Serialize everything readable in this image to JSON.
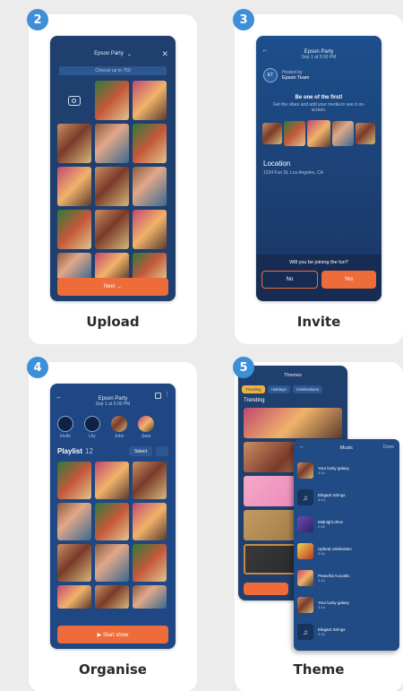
{
  "cards": [
    {
      "number": "2",
      "label": "Upload",
      "header_title": "Epson Party",
      "header_sub": "Choose up to 750",
      "next_label": "Next →"
    },
    {
      "number": "3",
      "label": "Invite",
      "event_title": "Epson Party",
      "event_date": "Sep 1 at 5:00 PM",
      "host_initials": "ET",
      "host_prefix": "Hosted by",
      "host_name": "Epson Team",
      "invite_heading": "Be one of the first!",
      "invite_body": "Get the vibes and add your media to see it on-screen.",
      "location_label": "Location",
      "location_value": "1234 Fun St, Los Angeles, CA",
      "question": "Will you be joining the fun?",
      "no_label": "No",
      "yes_label": "Yes"
    },
    {
      "number": "4",
      "label": "Organise",
      "event_title": "Epson Party",
      "event_date": "Sep 1 at 5:00 PM",
      "people": [
        "Invite",
        "Lily",
        "John",
        "Jane"
      ],
      "playlist_label": "Playlist",
      "playlist_count": "12",
      "select_label": "Select",
      "start_label": "▶ Start show"
    },
    {
      "number": "5",
      "label": "Theme",
      "themes_title": "Themes",
      "tabs": [
        "Trending",
        "Holidays",
        "Celebrations"
      ],
      "section_label": "Trending",
      "music_title": "Music",
      "music_done": "Done",
      "tracks": [
        {
          "name": "Your lucky galaxy",
          "time": "3:14"
        },
        {
          "name": "Elegant Strings",
          "time": "3:14"
        },
        {
          "name": "Midnight drive",
          "time": "2:45"
        },
        {
          "name": "Upbeat celebration",
          "time": "3:14"
        },
        {
          "name": "Peaceful Acoustic",
          "time": "3:14"
        },
        {
          "name": "Your lucky galaxy",
          "time": "3:14"
        },
        {
          "name": "Elegant Strings",
          "time": "3:14"
        }
      ]
    }
  ]
}
